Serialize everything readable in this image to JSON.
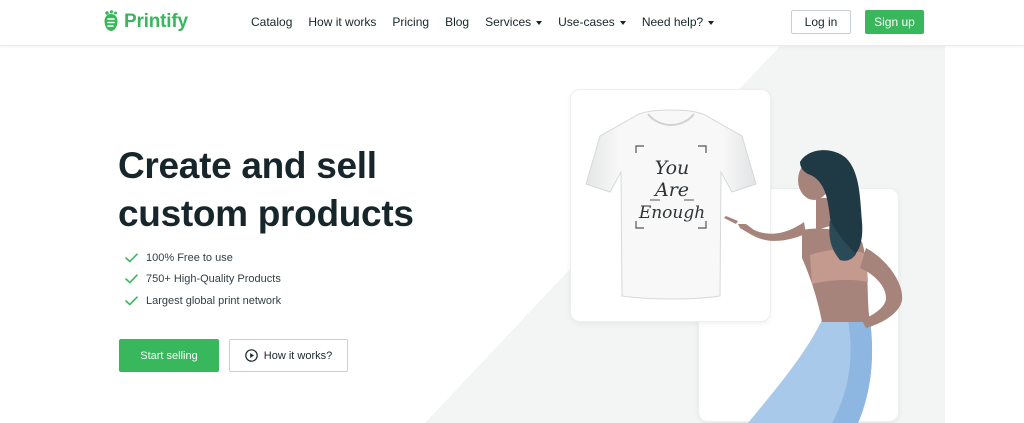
{
  "brand": {
    "name": "Printify",
    "color": "#39b75d"
  },
  "nav": {
    "items": [
      {
        "label": "Catalog",
        "dropdown": false
      },
      {
        "label": "How it works",
        "dropdown": false
      },
      {
        "label": "Pricing",
        "dropdown": false
      },
      {
        "label": "Blog",
        "dropdown": false
      },
      {
        "label": "Services",
        "dropdown": true
      },
      {
        "label": "Use-cases",
        "dropdown": true
      },
      {
        "label": "Need help?",
        "dropdown": true
      }
    ],
    "login_label": "Log in",
    "signup_label": "Sign up"
  },
  "hero": {
    "title": "Create and sell custom products",
    "features": [
      "100% Free to use",
      "750+ High-Quality Products",
      "Largest global print network"
    ],
    "primary_button": "Start selling",
    "secondary_button": "How it works?"
  },
  "illustration": {
    "shirt_print": "You Are Enough"
  },
  "icons": {
    "check": "check-icon",
    "play": "play-circle-icon",
    "caret": "chevron-down-icon"
  },
  "colors": {
    "accent": "#39b75d",
    "text": "#17262b",
    "background_shape": "#f4f5f5"
  }
}
